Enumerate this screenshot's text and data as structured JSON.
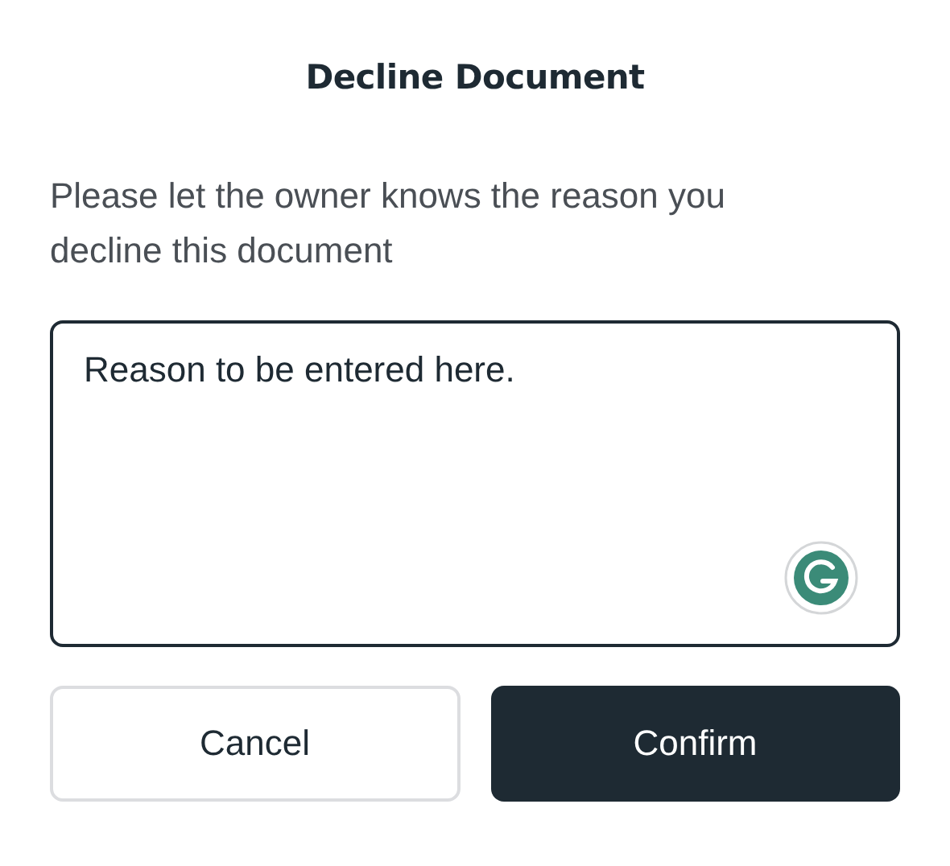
{
  "dialog": {
    "title": "Decline Document",
    "message": "Please let the owner knows the reason you decline this document",
    "reason_field": {
      "value": "Reason to be entered here."
    },
    "buttons": [
      {
        "label": "Cancel",
        "kind": "secondary"
      },
      {
        "label": "Confirm",
        "kind": "primary"
      }
    ]
  }
}
